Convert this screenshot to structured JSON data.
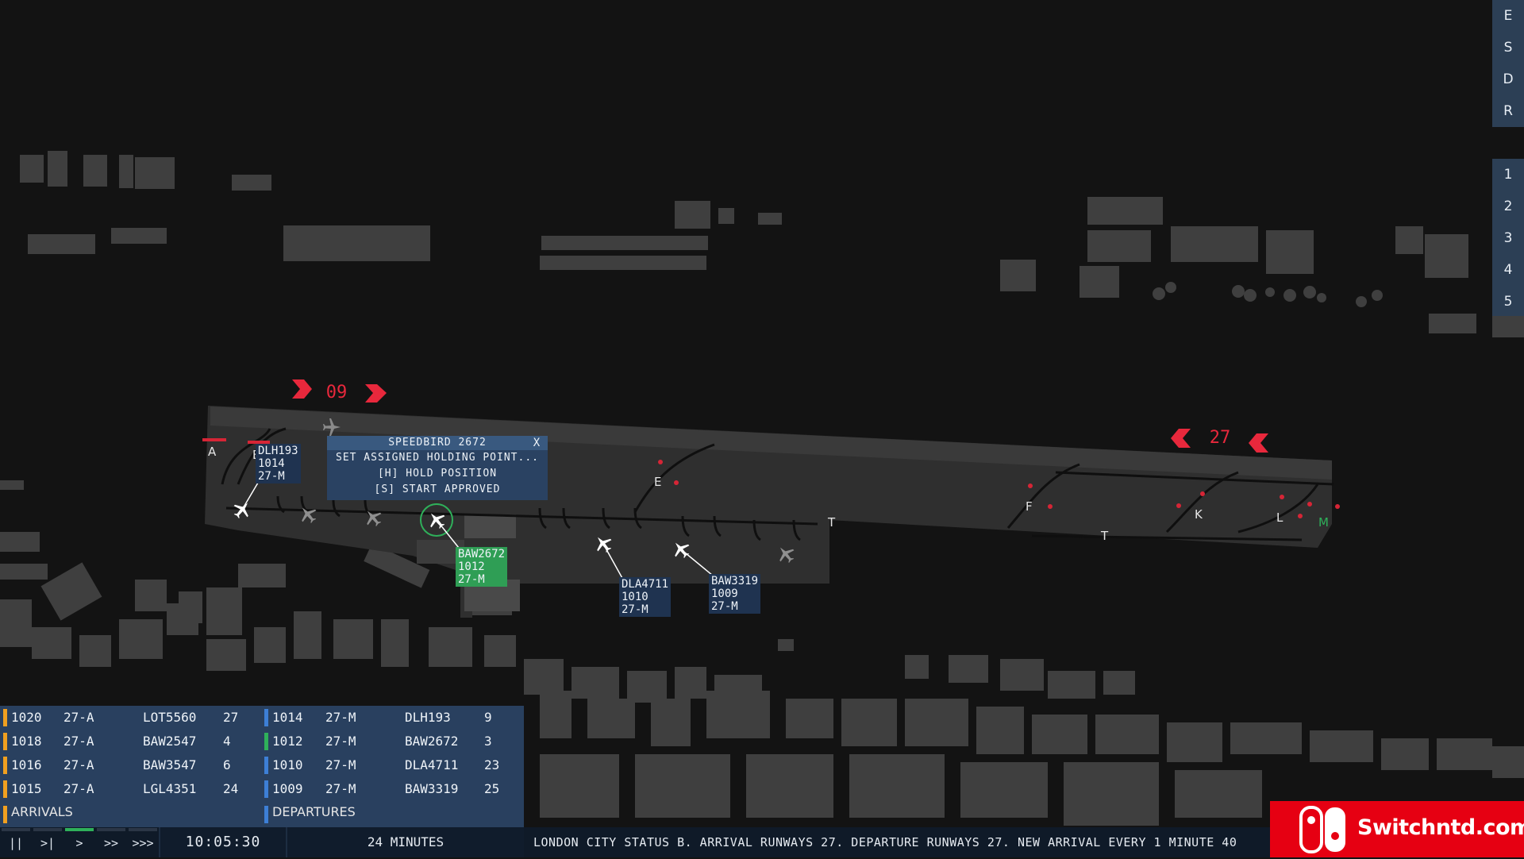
{
  "side_tools": [
    "E",
    "S",
    "D",
    "R"
  ],
  "side_numbers": [
    "1",
    "2",
    "3",
    "4",
    "5"
  ],
  "runways": {
    "west_label": "09",
    "east_label": "27"
  },
  "taxiway_labels": [
    "A",
    "B",
    "E",
    "F",
    "T",
    "T",
    "K",
    "L",
    "M"
  ],
  "popup": {
    "title": "SPEEDBIRD 2672",
    "close": "X",
    "items": [
      "SET ASSIGNED HOLDING POINT...",
      "[H] HOLD POSITION",
      "[S] START APPROVED"
    ]
  },
  "tags": [
    {
      "lines": [
        "DLH193",
        "1014",
        "27-M"
      ],
      "style": "dark"
    },
    {
      "lines": [
        "BAW2672",
        "1012",
        "27-M"
      ],
      "style": "green"
    },
    {
      "lines": [
        "DLA4711",
        "1010",
        "27-M"
      ],
      "style": "dark"
    },
    {
      "lines": [
        "BAW3319",
        "1009",
        "27-M"
      ],
      "style": "dark"
    }
  ],
  "arrivals": {
    "title": "ARRIVALS",
    "rows": [
      {
        "time": "1020",
        "runway": "27-A",
        "callsign": "LOT5560",
        "count": "27",
        "color": "#f0a020"
      },
      {
        "time": "1018",
        "runway": "27-A",
        "callsign": "BAW2547",
        "count": "4",
        "color": "#f0a020"
      },
      {
        "time": "1016",
        "runway": "27-A",
        "callsign": "BAW3547",
        "count": "6",
        "color": "#f0a020"
      },
      {
        "time": "1015",
        "runway": "27-A",
        "callsign": "LGL4351",
        "count": "24",
        "color": "#f0a020"
      }
    ]
  },
  "departures": {
    "title": "DEPARTURES",
    "rows": [
      {
        "time": "1014",
        "runway": "27-M",
        "callsign": "DLH193",
        "count": "9",
        "color": "#3d7fd6"
      },
      {
        "time": "1012",
        "runway": "27-M",
        "callsign": "BAW2672",
        "count": "3",
        "color": "#2fb05a"
      },
      {
        "time": "1010",
        "runway": "27-M",
        "callsign": "DLA4711",
        "count": "23",
        "color": "#3d7fd6"
      },
      {
        "time": "1009",
        "runway": "27-M",
        "callsign": "BAW3319",
        "count": "25",
        "color": "#3d7fd6"
      }
    ]
  },
  "controls": {
    "buttons": [
      "||",
      ">|",
      ">",
      ">>",
      ">>>"
    ],
    "active_index": 2,
    "clock": "10:05:30",
    "elapsed": "24 MINUTES",
    "ticker": "LONDON CITY STATUS B. ARRIVAL RUNWAYS 27. DEPARTURE RUNWAYS 27. NEW ARRIVAL EVERY 1 MINUTE 40"
  },
  "logo": {
    "text": "Switchntd.com"
  },
  "colors": {
    "runway_marker": "#e8283c",
    "panel": "#29405f",
    "highlight": "#2f9e55"
  }
}
